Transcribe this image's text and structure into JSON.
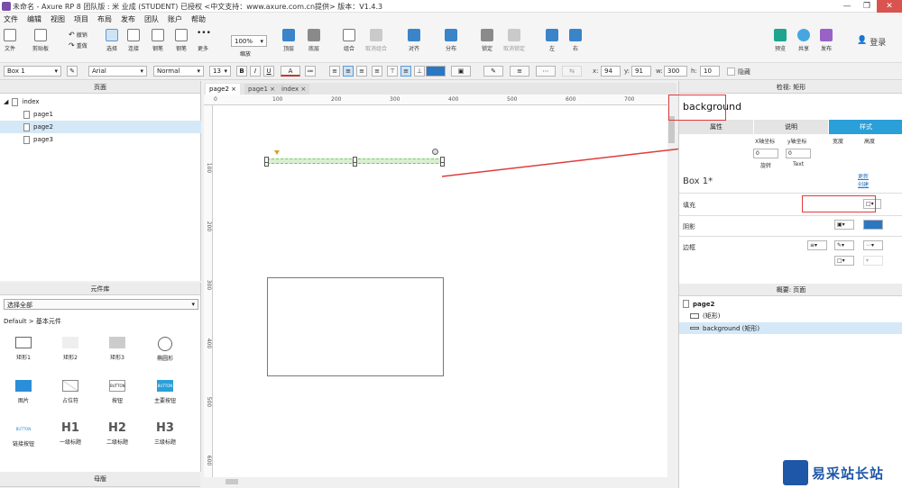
{
  "titlebar": {
    "title": "未命名 - Axure RP 8 团队版 : 米 业成 (STUDENT) 已授权      <中文支持：www.axure.com.cn提供> 版本：V1.4.3",
    "min": "—",
    "max": "❐",
    "close": "✕"
  },
  "menu": [
    "文件",
    "编辑",
    "视图",
    "项目",
    "布局",
    "发布",
    "团队",
    "账户",
    "帮助"
  ],
  "toolbar": {
    "file": "文件",
    "clipboard": "剪贴板",
    "cut": "剪切",
    "copy": "复制",
    "paste": "粘贴",
    "undo": "撤销",
    "redo": "重做",
    "select": "选择",
    "connect": "连接",
    "pen": "钢笔",
    "more": "更多",
    "zoom_value": "100%",
    "zoom_label": "缩放",
    "top": "顶层",
    "bottom": "底层",
    "group": "组合",
    "ungroup": "取消组合",
    "align": "对齐",
    "distribute": "分布",
    "lock": "锁定",
    "unlock": "取消锁定",
    "left": "左",
    "right": "右",
    "preview": "预览",
    "share": "共享",
    "publish": "发布",
    "login": "登录"
  },
  "format": {
    "widget_name": "Box 1",
    "font": "Arial",
    "style": "Normal",
    "size": "13",
    "bold": "B",
    "italic": "I",
    "underline": "U",
    "font_color": "A",
    "x_label": "x:",
    "x": "94",
    "y_label": "y:",
    "y": "91",
    "w_label": "w:",
    "w": "300",
    "h_label": "h:",
    "h": "10",
    "hidden": "隐藏"
  },
  "pages": {
    "header": "页面",
    "items": [
      {
        "label": "index"
      },
      {
        "label": "page1"
      },
      {
        "label": "page2"
      },
      {
        "label": "page3"
      }
    ]
  },
  "library": {
    "header": "元件库",
    "dropdown": "选择全部",
    "group": "Default > 基本元件",
    "widgets": [
      {
        "label": "矩形1"
      },
      {
        "label": "矩形2"
      },
      {
        "label": "矩形3"
      },
      {
        "label": "椭圆形"
      },
      {
        "label": "图片"
      },
      {
        "label": "占位符"
      },
      {
        "label": "按钮"
      },
      {
        "label": "主要按钮"
      },
      {
        "label": "链接按钮"
      },
      {
        "label": "一级标题"
      },
      {
        "label": "二级标题"
      },
      {
        "label": "三级标题"
      }
    ],
    "btn_text": "BUTTON",
    "h1": "H1",
    "h2": "H2",
    "h3": "H3"
  },
  "masters": {
    "header": "母版"
  },
  "canvas": {
    "tabs": [
      "page2",
      "page1",
      "index"
    ],
    "close_x": "×",
    "ruler_h": [
      "0",
      "100",
      "200",
      "300",
      "400",
      "500",
      "600",
      "700"
    ],
    "ruler_v": [
      "100",
      "200",
      "300",
      "400",
      "500",
      "600"
    ]
  },
  "inspector": {
    "header": "检视: 矩形",
    "name": "background",
    "tabs": [
      "属性",
      "说明",
      "样式"
    ],
    "xsel": "X轴坐标",
    "ysel": "y轴坐标",
    "width": "宽度",
    "height": "高度",
    "rotate_val": "0",
    "text_val": "0",
    "rotate": "旋转",
    "text": "Text",
    "style_name": "Box 1*",
    "update": "更新",
    "create": "创建",
    "fill": "填充",
    "shadow": "阴影",
    "border": "边框"
  },
  "outline": {
    "header": "概要: 页面",
    "page": "page2",
    "items": [
      "(矩形)",
      "background (矩形)"
    ]
  },
  "watermark": {
    "text": "易采站长站"
  }
}
